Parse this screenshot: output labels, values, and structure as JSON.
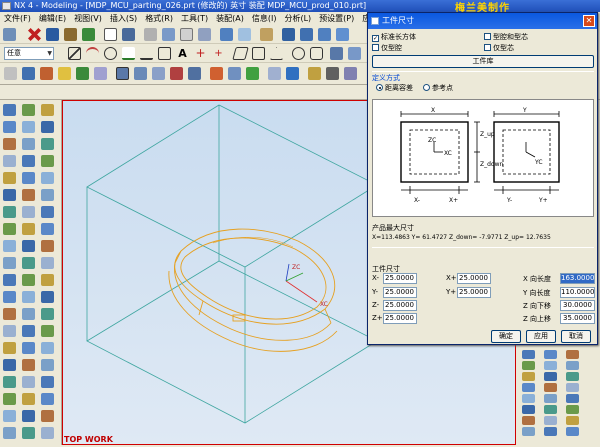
{
  "window": {
    "title": "NX 4 - Modeling - [MDP_MCU_parting_026.prt (修改的)  英寸 装配 MDP_MCU_prod_010.prt]"
  },
  "watermark": "梅兰美制作",
  "menubar": [
    "文件(F)",
    "编辑(E)",
    "视图(V)",
    "插入(S)",
    "格式(R)",
    "工具(T)",
    "装配(A)",
    "信息(I)",
    "分析(L)",
    "预设置(P)",
    "应用(N)"
  ],
  "toolbar": {
    "filter_value": "任意"
  },
  "viewport": {
    "label": "TOP WORK",
    "axis_x": "XC",
    "axis_z": "ZC"
  },
  "dialog": {
    "title": "工件尺寸",
    "close": "✕",
    "options": [
      {
        "label": "标准长方体",
        "checked": true
      },
      {
        "label": "型腔和型芯",
        "checked": false
      },
      {
        "label": "仅型腔",
        "checked": false
      },
      {
        "label": "仅型芯",
        "checked": false
      }
    ],
    "library_button": "工件库",
    "define_method": {
      "label": "定义方式",
      "options": [
        {
          "label": "距离容差",
          "selected": true
        },
        {
          "label": "参考点",
          "selected": false
        }
      ]
    },
    "diagram": {
      "x": "X",
      "y": "Y",
      "z_up": "Z_up",
      "z_down": "Z_down",
      "x_minus": "X-",
      "x_plus": "X+",
      "y_minus": "Y-",
      "y_plus": "Y+",
      "xc": "XC",
      "yc": "YC",
      "zc": "ZC"
    },
    "product_size": {
      "label": "产品最大尺寸",
      "values": "X=113.4863   Y= 61.4727   Z_down= -7.9771   Z_up= 12.7635"
    },
    "workpiece": {
      "label": "工件尺寸",
      "left_fields": [
        {
          "label": "X-",
          "value": "25.0000"
        },
        {
          "label": "Y-",
          "value": "25.0000"
        },
        {
          "label": "Z-",
          "value": "25.0000"
        },
        {
          "label": "Z+",
          "value": "25.0000"
        }
      ],
      "mid_fields": [
        {
          "label": "X+",
          "value": "25.0000"
        },
        {
          "label": "Y+",
          "value": "25.0000"
        }
      ],
      "right_fields": [
        {
          "label": "X 向长度",
          "value": "163.0000",
          "selected": true
        },
        {
          "label": "Y 向长度",
          "value": "110.0000",
          "selected": false
        },
        {
          "label": "Z 向下移",
          "value": "30.0000",
          "selected": false
        },
        {
          "label": "Z 向上移",
          "value": "35.0000",
          "selected": false
        }
      ]
    },
    "buttons": {
      "ok": "确定",
      "apply": "应用",
      "cancel": "取消"
    }
  }
}
